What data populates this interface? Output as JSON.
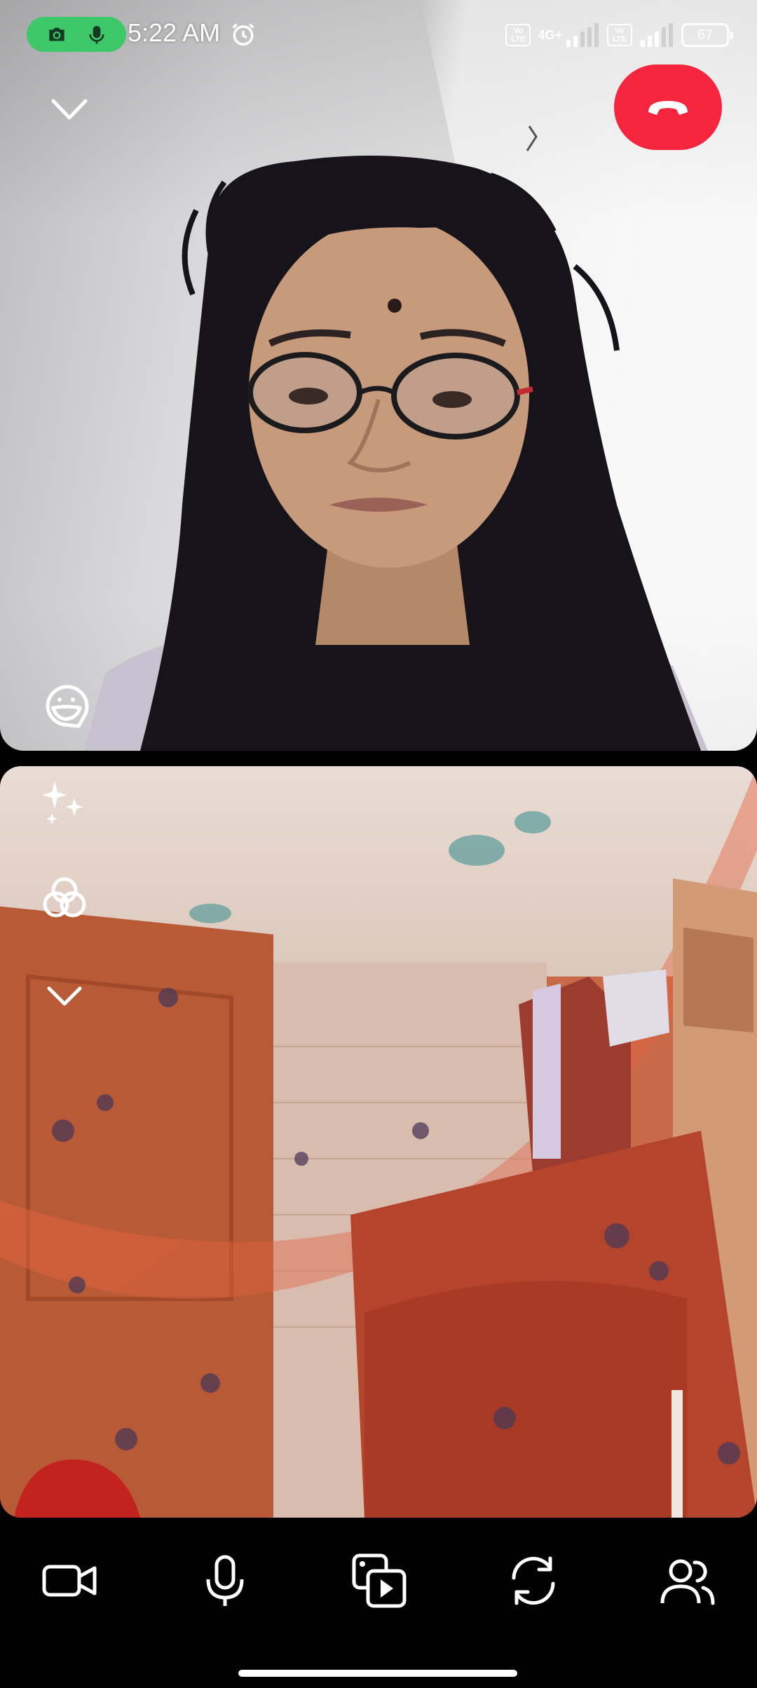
{
  "status_bar": {
    "time": "5:22 AM",
    "network_type": "4G+",
    "volte_label_1": "Vo LTE",
    "volte_label_2": "Vo LTE",
    "battery": "67",
    "indicator_icons": [
      "camera-icon",
      "microphone-icon"
    ],
    "alarm_icon": "alarm-clock-icon",
    "colors": {
      "active_indicator": "#3ec86a"
    }
  },
  "remote_video": {
    "collapse_icon": "chevron-down-icon",
    "end_call_icon": "hang-up-icon",
    "sticker_icon": "sticker-icon",
    "colors": {
      "end_call": "#f5243f"
    }
  },
  "local_video": {
    "tools": [
      "sparkles-icon",
      "color-filter-icon",
      "chevron-down-icon"
    ]
  },
  "controls": [
    {
      "name": "camera-toggle",
      "icon": "video-camera-icon"
    },
    {
      "name": "microphone-toggle",
      "icon": "microphone-icon"
    },
    {
      "name": "share-media",
      "icon": "media-play-icon"
    },
    {
      "name": "flip-camera",
      "icon": "flip-camera-icon"
    },
    {
      "name": "participants",
      "icon": "people-icon"
    }
  ]
}
